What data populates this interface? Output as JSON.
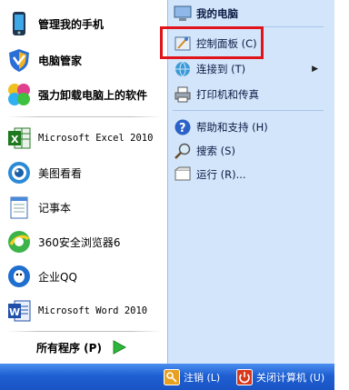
{
  "left": {
    "pinned": [
      {
        "label": "管理我的手机",
        "icon": "phone-icon"
      },
      {
        "label": "电脑管家",
        "icon": "shield-icon"
      },
      {
        "label": "强力卸载电脑上的软件",
        "icon": "uninstall-icon"
      }
    ],
    "recent": [
      {
        "label": "Microsoft Excel 2010",
        "icon": "excel-icon"
      },
      {
        "label": "美图看看",
        "icon": "meitu-icon"
      },
      {
        "label": "记事本",
        "icon": "notepad-icon"
      },
      {
        "label": "360安全浏览器6",
        "icon": "browser-360-icon"
      },
      {
        "label": "企业QQ",
        "icon": "qq-icon"
      },
      {
        "label": "Microsoft Word 2010",
        "icon": "word-icon"
      }
    ],
    "all_programs": "所有程序 (P)"
  },
  "right": {
    "my_computer": "我的电脑",
    "control_panel": "控制面板 (C)",
    "connect_to": "连接到 (T)",
    "printers": "打印机和传真",
    "help": "帮助和支持 (H)",
    "search": "搜索 (S)",
    "run": "运行 (R)..."
  },
  "bottom": {
    "logoff": "注销 (L)",
    "shutdown": "关闭计算机 (U)"
  },
  "colors": {
    "highlight": "#e0141a",
    "right_pane": "#d3e5fa",
    "bottom_bar": "#1e5fd2"
  }
}
